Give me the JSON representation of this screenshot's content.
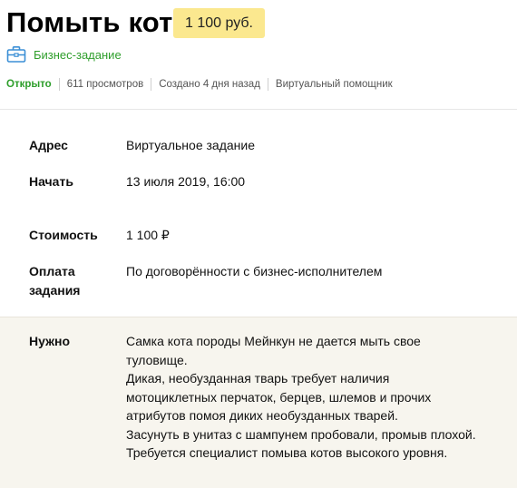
{
  "task": {
    "title": "Помыть кота",
    "price_badge": "1 100 руб.",
    "business_label": "Бизнес-задание",
    "status": "Открыто",
    "views": "611 просмотров",
    "created": "Создано 4 дня назад",
    "assistant": "Виртуальный помощник"
  },
  "details": {
    "address_label": "Адрес",
    "address_value": "Виртуальное задание",
    "start_label": "Начать",
    "start_value": "13 июля 2019, 16:00",
    "cost_label": "Стоимость",
    "cost_value": "1 100 ₽",
    "payment_label_line1": "Оплата",
    "payment_label_line2": "задания",
    "payment_value": "По договорённости с бизнес-исполнителем"
  },
  "needs": {
    "label": "Нужно",
    "lines": [
      "Самка кота породы Мейнкун не дается мыть свое",
      "туловище.",
      "Дикая, необузданная тварь требует наличия",
      "мотоциклетных перчаток, берцев, шлемов и прочих",
      "атрибутов помоя диких необузданных тварей.",
      "Засунуть в унитаз с шампунем пробовали, промыв плохой.",
      "Требуется специалист помыва котов высокого уровня."
    ]
  },
  "colors": {
    "accent_green": "#2e9e2b",
    "price_badge_bg": "#fbe88f",
    "needs_bg": "#f7f5ee"
  },
  "icons": {
    "business": "briefcase-icon"
  }
}
